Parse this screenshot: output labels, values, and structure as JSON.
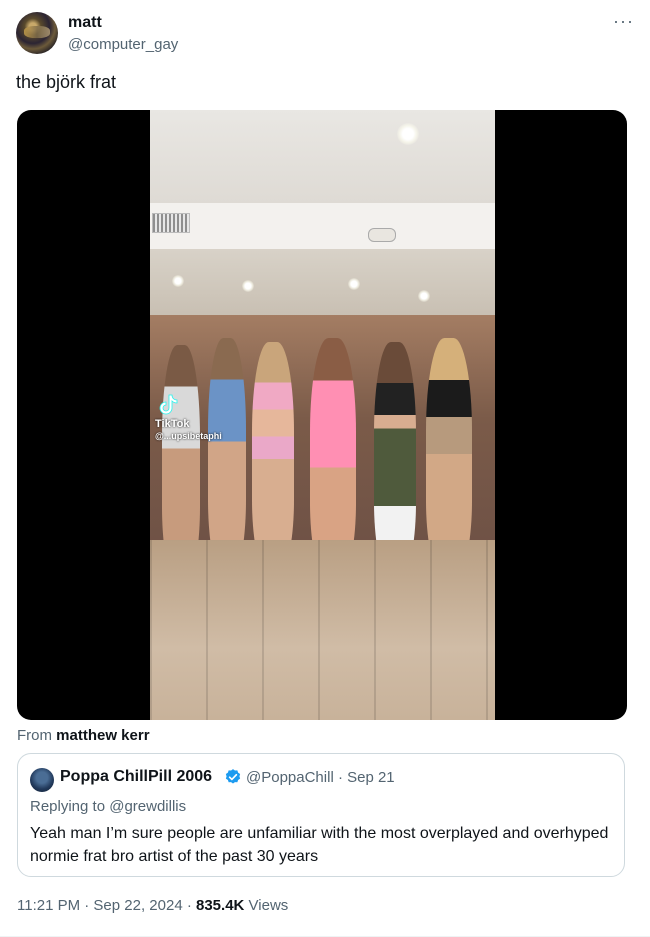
{
  "author": {
    "name": "matt",
    "handle": "@computer_gay",
    "more_icon": "more-horizontal-icon"
  },
  "tweet": {
    "text": "the björk frat"
  },
  "media": {
    "watermark_brand": "TikTok",
    "watermark_handle": "@...upsibetaphi",
    "attribution_prefix": "From",
    "attribution_name": "matthew kerr"
  },
  "quote": {
    "name": "Poppa ChillPill 2006",
    "verified_icon": "verified-badge-icon",
    "handle_date": "@PoppaChill · Sep 21",
    "replying_prefix": "Replying to",
    "replying_to": "@grewdillis",
    "text": "Yeah man I’m sure people are unfamiliar with the most overplayed and overhyped normie frat bro artist of the past 30 years"
  },
  "meta": {
    "time_date": "11:21 PM · Sep 22, 2024 · ",
    "views_count": "835.4K",
    "views_label": "Views"
  },
  "colors": {
    "text_primary": "#0f1419",
    "text_secondary": "#536471",
    "verified_blue": "#1d9bf0",
    "border": "#cfd9de"
  }
}
